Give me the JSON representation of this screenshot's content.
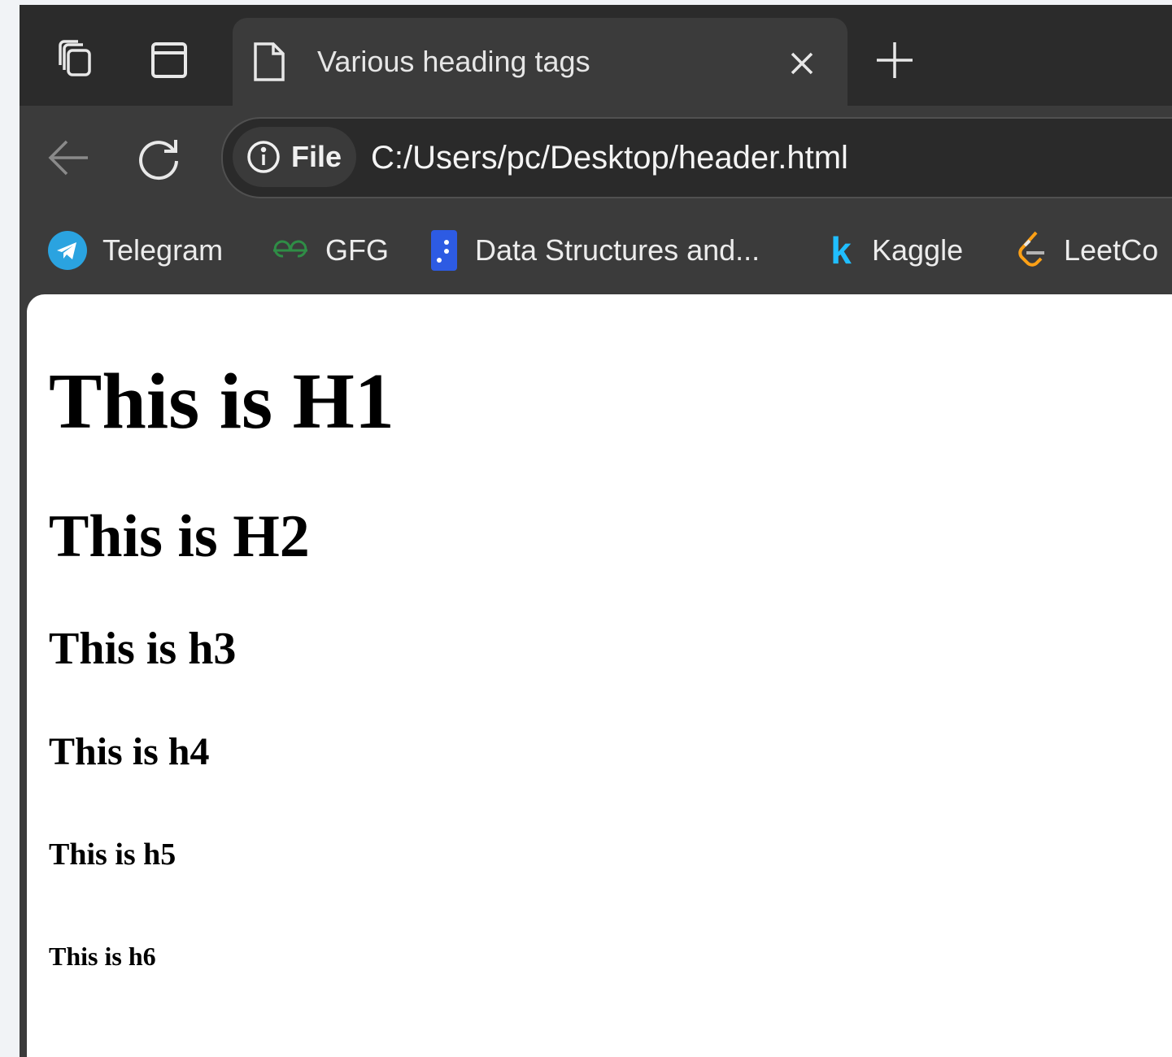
{
  "tab": {
    "title": "Various heading tags"
  },
  "address_bar": {
    "chip_label": "File",
    "url": "C:/Users/pc/Desktop/header.html"
  },
  "bookmarks": [
    {
      "label": "Telegram",
      "icon": "telegram-icon"
    },
    {
      "label": "GFG",
      "icon": "gfg-icon"
    },
    {
      "label": "Data Structures and...",
      "icon": "data-structures-icon"
    },
    {
      "label": "Kaggle",
      "icon": "kaggle-icon"
    },
    {
      "label": "LeetCo",
      "icon": "leetcode-icon"
    }
  ],
  "page": {
    "h1": "This is H1",
    "h2": "This is H2",
    "h3": "This is h3",
    "h4": "This is h4",
    "h5": "This is h5",
    "h6": "This is h6"
  },
  "colors": {
    "tabstrip_bg": "#2b2b2b",
    "toolbar_bg": "#3b3b3b",
    "content_bg": "#ffffff",
    "telegram_blue": "#2aa3e0",
    "gfg_green": "#2f8d46",
    "kaggle_blue": "#20beff",
    "leetcode_orange": "#ffa116"
  }
}
